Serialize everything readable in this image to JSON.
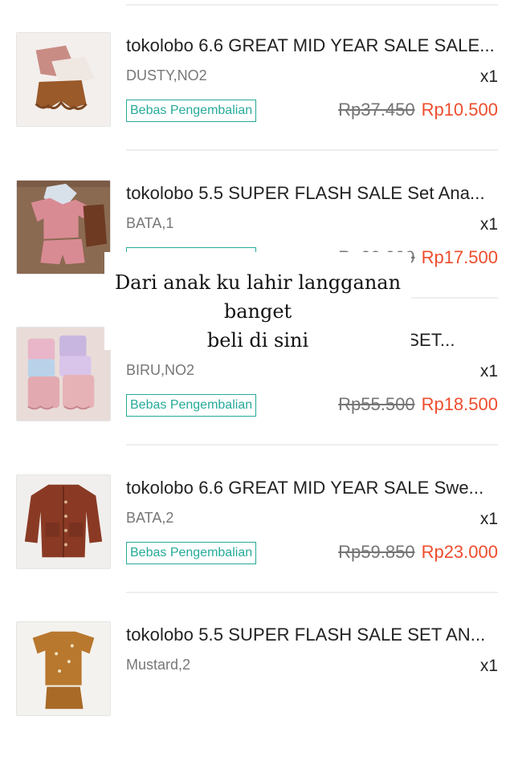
{
  "orders": [
    {
      "title": "tokolobo 6.6 GREAT MID YEAR SALE SALE...",
      "variant": "DUSTY,NO2",
      "qty": "x1",
      "badge": "Bebas Pengembalian",
      "price_original": "Rp37.450",
      "price_final": "Rp10.500",
      "thumb_icon": "pink-ruffle-shorts-set"
    },
    {
      "title": "tokolobo 5.5 SUPER FLASH SALE Set Ana...",
      "variant": "BATA,1",
      "qty": "x1",
      "badge": "Bebas Pengembalian",
      "price_original": "Rp29.999",
      "price_final": "Rp17.500",
      "thumb_icon": "pink-tshirt-shorts-set"
    },
    {
      "title": "tokolobo 5.5 SUPER FLASH SALE SET...",
      "variant": "BIRU,NO2",
      "qty": "x1",
      "badge": "Bebas Pengembalian",
      "price_original": "Rp55.500",
      "price_final": "Rp18.500",
      "thumb_icon": "pastel-rompers-set"
    },
    {
      "title": "tokolobo 6.6 GREAT MID YEAR SALE Swe...",
      "variant": "BATA,2",
      "qty": "x1",
      "badge": "Bebas Pengembalian",
      "price_original": "Rp59.850",
      "price_final": "Rp23.000",
      "thumb_icon": "brown-cardigan"
    },
    {
      "title": "tokolobo 5.5 SUPER FLASH SALE SET AN...",
      "variant": "Mustard,2",
      "qty": "x1",
      "badge": "Bebas Pengembalian",
      "price_original": "",
      "price_final": "",
      "thumb_icon": "mustard-tshirt-set"
    }
  ],
  "caption": {
    "line1": "Dari anak ku lahir langganan",
    "line2": "banget",
    "line3": "beli di sini"
  },
  "colors": {
    "accent_price": "#ee4d2d",
    "badge": "#26aa99",
    "divider": "#eeeeee"
  }
}
